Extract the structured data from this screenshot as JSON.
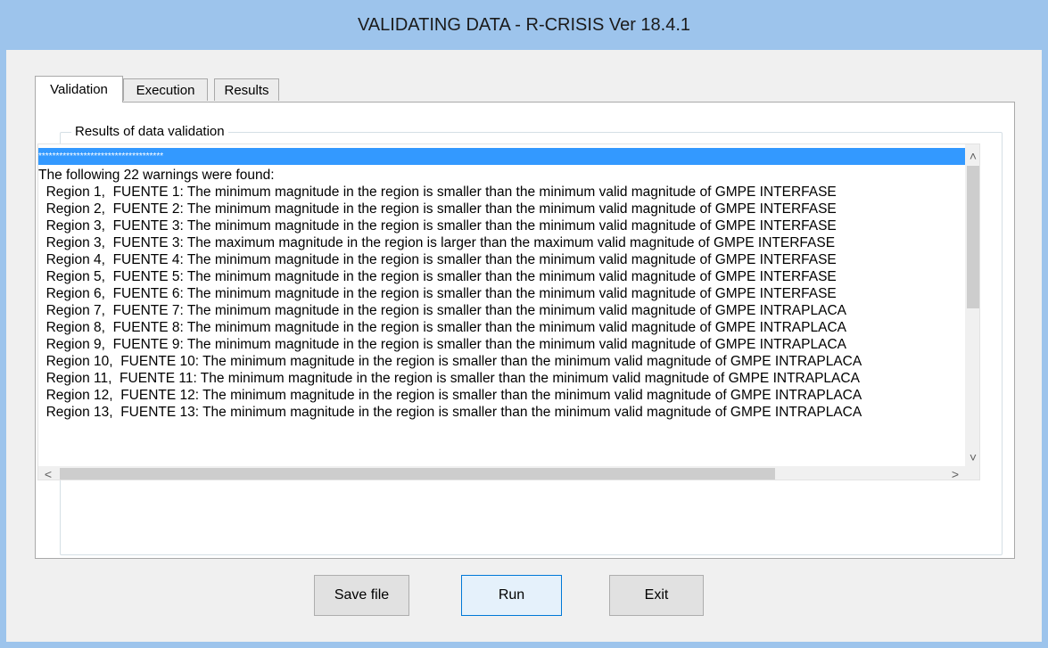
{
  "window": {
    "title": "VALIDATING DATA - R-CRISIS Ver 18.4.1"
  },
  "tabs": [
    {
      "label": "Validation",
      "active": true
    },
    {
      "label": "Execution",
      "active": false
    },
    {
      "label": "Results",
      "active": false
    }
  ],
  "validation": {
    "group_title": "Results of data validation",
    "lines": [
      "************************************",
      "The following 22 warnings were found:",
      "  Region 1,  FUENTE 1: The minimum magnitude in the region is smaller than the minimum valid magnitude of GMPE INTERFASE",
      "  Region 2,  FUENTE 2: The minimum magnitude in the region is smaller than the minimum valid magnitude of GMPE INTERFASE",
      "  Region 3,  FUENTE 3: The minimum magnitude in the region is smaller than the minimum valid magnitude of GMPE INTERFASE",
      "  Region 3,  FUENTE 3: The maximum magnitude in the region is larger than the maximum valid magnitude of GMPE INTERFASE",
      "  Region 4,  FUENTE 4: The minimum magnitude in the region is smaller than the minimum valid magnitude of GMPE INTERFASE",
      "  Region 5,  FUENTE 5: The minimum magnitude in the region is smaller than the minimum valid magnitude of GMPE INTERFASE",
      "  Region 6,  FUENTE 6: The minimum magnitude in the region is smaller than the minimum valid magnitude of GMPE INTERFASE",
      "  Region 7,  FUENTE 7: The minimum magnitude in the region is smaller than the minimum valid magnitude of GMPE INTRAPLACA",
      "  Region 8,  FUENTE 8: The minimum magnitude in the region is smaller than the minimum valid magnitude of GMPE INTRAPLACA",
      "  Region 9,  FUENTE 9: The minimum magnitude in the region is smaller than the minimum valid magnitude of GMPE INTRAPLACA",
      "  Region 10,  FUENTE 10: The minimum magnitude in the region is smaller than the minimum valid magnitude of GMPE INTRAPLACA",
      "  Region 11,  FUENTE 11: The minimum magnitude in the region is smaller than the minimum valid magnitude of GMPE INTRAPLACA",
      "  Region 12,  FUENTE 12: The minimum magnitude in the region is smaller than the minimum valid magnitude of GMPE INTRAPLACA",
      "  Region 13,  FUENTE 13: The minimum magnitude in the region is smaller than the minimum valid magnitude of GMPE INTRAPLACA"
    ],
    "selected_index": 0
  },
  "buttons": {
    "save": "Save file",
    "run": "Run",
    "exit": "Exit"
  },
  "icons": {
    "scroll_up": "chevron-up-icon",
    "scroll_down": "chevron-down-icon",
    "scroll_left": "chevron-left-icon",
    "scroll_right": "chevron-right-icon"
  },
  "colors": {
    "frame": "#9dc4ec",
    "selection": "#3399ff",
    "default_button_border": "#0078d7"
  }
}
